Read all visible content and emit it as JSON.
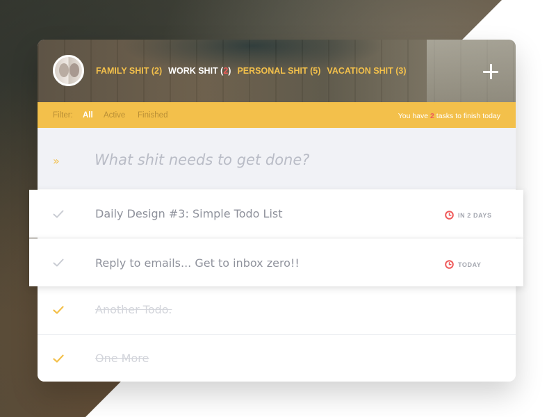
{
  "header": {
    "avatar_alt": "profile",
    "lists": [
      {
        "name": "FAMILY SHIT",
        "count": "2",
        "active": false
      },
      {
        "name": "WORK SHIT",
        "count": "2",
        "active": true
      },
      {
        "name": "PERSONAL SHIT",
        "count": "5",
        "active": false
      },
      {
        "name": "VACATION SHIT",
        "count": "3",
        "active": false
      }
    ]
  },
  "filter": {
    "label": "Filter:",
    "options": [
      "All",
      "Active",
      "Finished"
    ],
    "selected": "All"
  },
  "summary": {
    "prefix": "You have",
    "count": "2",
    "suffix": "tasks to finish today"
  },
  "new_todo": {
    "placeholder": "What shit needs to get done?",
    "value": ""
  },
  "todos": [
    {
      "title": "Daily Design #3: Simple Todo List",
      "due": "IN 2 DAYS",
      "done": false
    },
    {
      "title": "Reply to emails... Get to inbox zero!!",
      "due": "TODAY",
      "done": false
    },
    {
      "title": "Another Todo.",
      "due": "",
      "done": true
    },
    {
      "title": "One More",
      "due": "",
      "done": true
    }
  ],
  "colors": {
    "accent": "#f3c04b",
    "highlight": "#ef5a5a",
    "muted_text": "#8f929c",
    "done_text": "#d3d5db",
    "input_bg": "#f1f2f6"
  },
  "icons": {
    "add": "plus-icon",
    "input_prefix": "double-chevron-right-icon",
    "check": "check-icon",
    "due": "clock-icon"
  }
}
